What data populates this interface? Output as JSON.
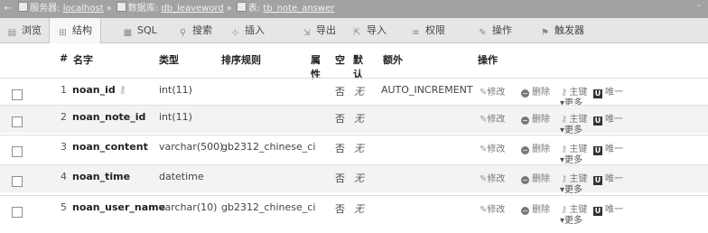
{
  "breadcrumb": {
    "server_label": "服务器:",
    "server": "localhost",
    "db_label": "数据库:",
    "db": "db_leaveword",
    "table_label": "表:",
    "table": "tb_note_answer",
    "sep": "»",
    "back_glyph": "←",
    "minimize_glyph": "⌃"
  },
  "tabs": [
    {
      "label": "浏览",
      "icon": "browse-icon",
      "glyph": "▤"
    },
    {
      "label": "结构",
      "icon": "structure-icon",
      "glyph": "⊞",
      "active": true
    },
    {
      "label": "SQL",
      "icon": "sql-icon",
      "glyph": "▦"
    },
    {
      "label": "搜索",
      "icon": "search-icon",
      "glyph": "⚲"
    },
    {
      "label": "插入",
      "icon": "insert-icon",
      "glyph": "⊹"
    },
    {
      "label": "导出",
      "icon": "export-icon",
      "glyph": "⇲"
    },
    {
      "label": "导入",
      "icon": "import-icon",
      "glyph": "⇱"
    },
    {
      "label": "权限",
      "icon": "privileges-icon",
      "glyph": "≡"
    },
    {
      "label": "操作",
      "icon": "operations-icon",
      "glyph": "✎"
    },
    {
      "label": "触发器",
      "icon": "triggers-icon",
      "glyph": "⚑"
    }
  ],
  "table": {
    "headers": {
      "num": "#",
      "name": "名字",
      "type": "类型",
      "collation": "排序规则",
      "attr1": "属",
      "attr2": "性",
      "null": "空",
      "default1": "默",
      "default2": "认",
      "extra": "额外",
      "action": "操作"
    },
    "rows": [
      {
        "num": "1",
        "name": "noan_id",
        "key_icon": true,
        "type": "int(11)",
        "collation": "",
        "null": "否",
        "default": "无",
        "extra": "AUTO_INCREMENT"
      },
      {
        "num": "2",
        "name": "noan_note_id",
        "key_icon": false,
        "type": "int(11)",
        "collation": "",
        "null": "否",
        "default": "无",
        "extra": ""
      },
      {
        "num": "3",
        "name": "noan_content",
        "key_icon": false,
        "type": "varchar(500)",
        "collation": "gb2312_chinese_ci",
        "null": "否",
        "default": "无",
        "extra": ""
      },
      {
        "num": "4",
        "name": "noan_time",
        "key_icon": false,
        "type": "datetime",
        "collation": "",
        "null": "否",
        "default": "无",
        "extra": ""
      },
      {
        "num": "5",
        "name": "noan_user_name",
        "key_icon": false,
        "type": "varchar(10)",
        "collation": "gb2312_chinese_ci",
        "null": "否",
        "default": "无",
        "extra": ""
      }
    ],
    "actions": {
      "edit": "修改",
      "delete": "删除",
      "primary": "主键",
      "unique": "唯一",
      "unique_glyph": "U",
      "more": "更多"
    }
  }
}
